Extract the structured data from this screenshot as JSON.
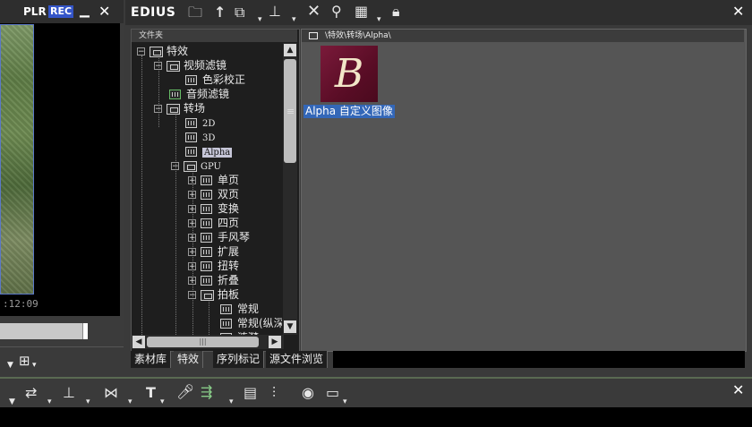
{
  "preview": {
    "title": "PLR",
    "rec_badge": "REC",
    "timecode": ":12:09"
  },
  "app": {
    "title": "EDIUS"
  },
  "folder_pane": {
    "header": "文件夹",
    "tree": [
      {
        "label": "特效",
        "expander": "−"
      },
      {
        "label": "视频滤镜",
        "expander": "−"
      },
      {
        "label": "色彩校正"
      },
      {
        "label": "音频滤镜"
      },
      {
        "label": "转场",
        "expander": "−"
      },
      {
        "label": "2D"
      },
      {
        "label": "3D"
      },
      {
        "label": "Alpha"
      },
      {
        "label": "GPU",
        "expander": "−"
      },
      {
        "label": "单页",
        "expander": "+"
      },
      {
        "label": "双页",
        "expander": "+"
      },
      {
        "label": "变换",
        "expander": "+"
      },
      {
        "label": "四页",
        "expander": "+"
      },
      {
        "label": "手风琴",
        "expander": "+"
      },
      {
        "label": "扩展",
        "expander": "+"
      },
      {
        "label": "扭转",
        "expander": "+"
      },
      {
        "label": "折叠",
        "expander": "+"
      },
      {
        "label": "拍板",
        "expander": "−"
      },
      {
        "label": "常规"
      },
      {
        "label": "常规(纵深"
      },
      {
        "label": "涟漪"
      }
    ]
  },
  "content": {
    "path": "\\特效\\转场\\Alpha\\",
    "items": [
      {
        "letter": "B",
        "label": "Alpha 自定义图像"
      }
    ]
  },
  "tabs": [
    "素材库",
    "特效",
    "序列标记",
    "源文件浏览"
  ],
  "colors": {
    "selection": "#3367b8",
    "rec_badge": "#3455c8",
    "thumb_bg": "#7a1a3a"
  }
}
